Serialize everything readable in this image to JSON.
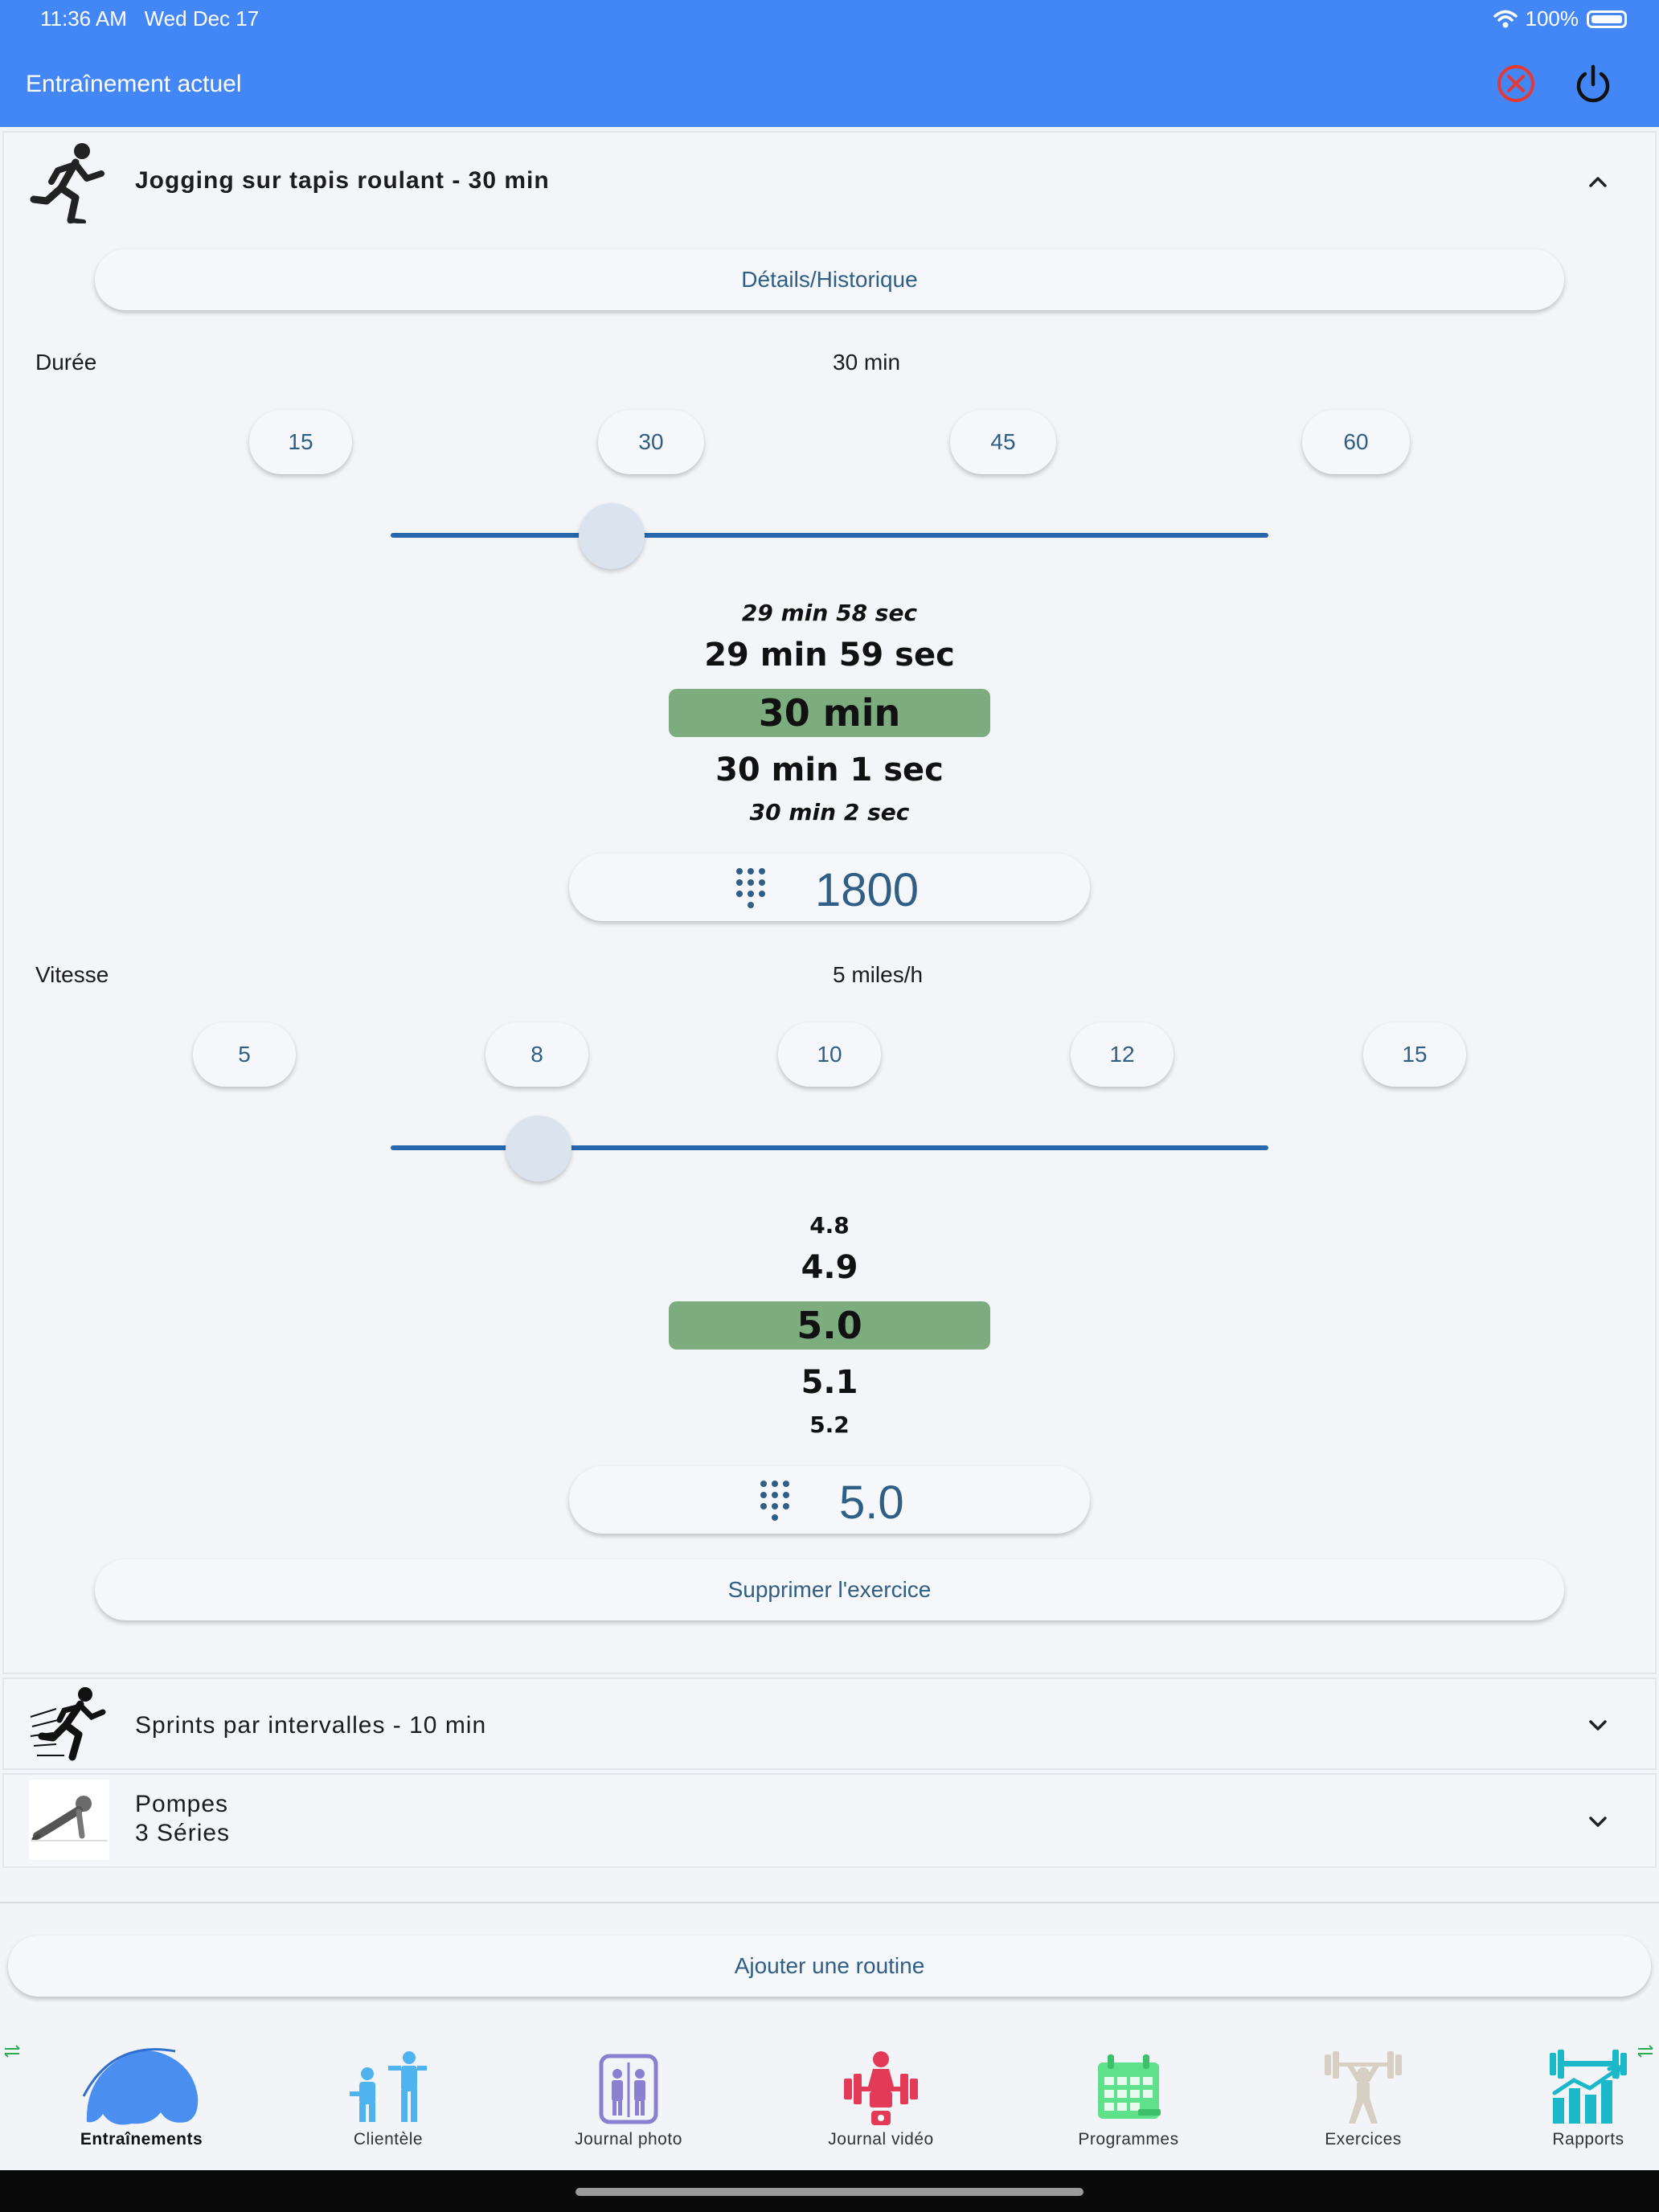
{
  "status_bar": {
    "time": "11:36 AM",
    "date": "Wed Dec 17",
    "battery": "100%"
  },
  "header": {
    "title": "Entraînement actuel",
    "cancel_icon": "cancel-circle-icon",
    "power_icon": "power-icon"
  },
  "exercise": {
    "title": "Jogging sur tapis roulant - 30 min",
    "icon": "runner-icon",
    "details_button": "Détails/Historique",
    "duration": {
      "label": "Durée",
      "value": "30 min",
      "presets": [
        "15",
        "30",
        "45",
        "60"
      ],
      "slider_fraction": 0.25,
      "picker": [
        "29 min 58 sec",
        "29 min 59 sec",
        "30 min",
        "30 min 1 sec",
        "30 min 2 sec"
      ],
      "input_value": "1800",
      "keypad_icon": "keypad-icon"
    },
    "speed": {
      "label": "Vitesse",
      "value": "5 miles/h",
      "presets": [
        "5",
        "8",
        "10",
        "12",
        "15"
      ],
      "slider_fraction": 0.17,
      "picker": [
        "4.8",
        "4.9",
        "5.0",
        "5.1",
        "5.2"
      ],
      "input_value": "5.0",
      "keypad_icon": "keypad-icon"
    },
    "delete_button": "Supprimer l'exercice"
  },
  "other_exercises": [
    {
      "title": "Sprints par intervalles - 10 min",
      "icon": "sprinter-icon"
    },
    {
      "title": "Pompes",
      "subtitle": "3 Séries",
      "icon": "pushup-icon"
    }
  ],
  "add_routine_button": "Ajouter une routine",
  "bottom_nav": [
    {
      "label": "Entraînements",
      "icon": "muscle-arm-icon",
      "active": true,
      "color": "#4a8ff0"
    },
    {
      "label": "Clientèle",
      "icon": "trainer-client-icon",
      "active": false,
      "color": "#4fb3ef"
    },
    {
      "label": "Journal photo",
      "icon": "photo-journal-icon",
      "active": false,
      "color": "#8a7fd0"
    },
    {
      "label": "Journal vidéo",
      "icon": "video-journal-icon",
      "active": false,
      "color": "#e33a57"
    },
    {
      "label": "Programmes",
      "icon": "calendar-icon",
      "active": false,
      "color": "#5fe08a"
    },
    {
      "label": "Exercices",
      "icon": "weightlifter-icon",
      "active": false,
      "color": "#d8cfc4"
    },
    {
      "label": "Rapports",
      "icon": "reports-chart-icon",
      "active": false,
      "color": "#1bb8c9"
    }
  ]
}
